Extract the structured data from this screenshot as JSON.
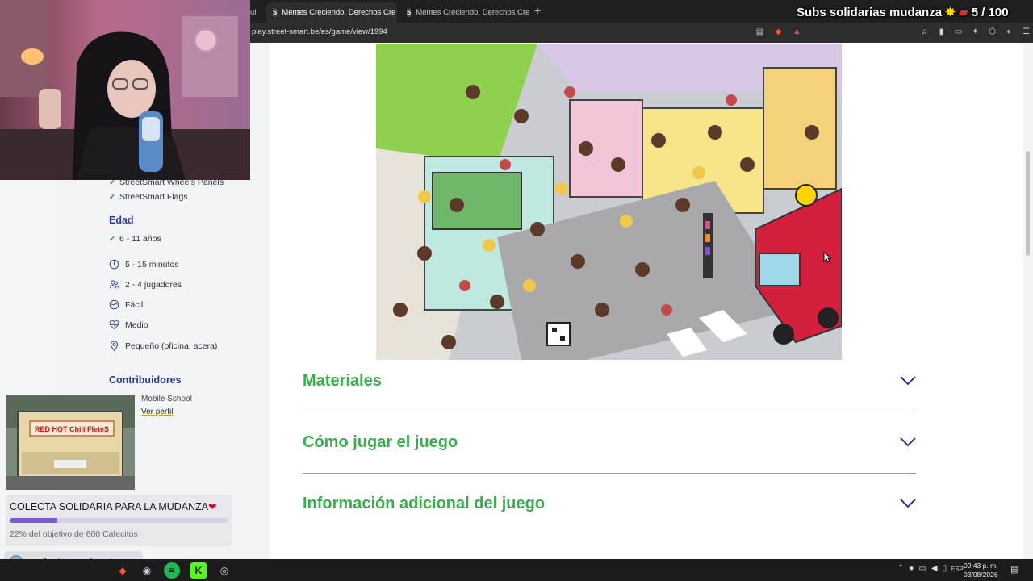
{
  "browser": {
    "tabs": [
      {
        "label": "ul",
        "active": false
      },
      {
        "label": "Mentes Creciendo, Derechos Cre",
        "favicon": "S",
        "active": true
      },
      {
        "label": "Mentes Creciendo, Derechos Crecien",
        "favicon": "S",
        "active": false
      }
    ],
    "new_tab_icon": "plus-icon",
    "url": "play.street-smart.be/es/game/view/1994"
  },
  "stream_overlay": {
    "title": "Subs solidarias mudanza",
    "counter": "5 / 100"
  },
  "sidebar": {
    "partial_items": [
      "StreetSmart Wheels Panels",
      "StreetSmart Flags"
    ],
    "age_heading": "Edad",
    "age_value": "6 - 11 años",
    "details": [
      {
        "icon": "clock-icon",
        "label": "5 - 15 minutos"
      },
      {
        "icon": "players-icon",
        "label": "2 - 4 jugadores"
      },
      {
        "icon": "easy-icon",
        "label": "Fácil"
      },
      {
        "icon": "heartbeat-icon",
        "label": "Medio"
      },
      {
        "icon": "location-pin-icon",
        "label": "Pequeño (oficina, acera)"
      }
    ],
    "contributors_heading": "Contribuidores",
    "contributor_name": "Mobile School",
    "contributor_link": "Ver perfil"
  },
  "accordion": [
    {
      "title": "Materiales"
    },
    {
      "title": "Cómo jugar el juego"
    },
    {
      "title": "Información adicional del juego"
    }
  ],
  "donation": {
    "title": "COLECTA SOLIDARIA PARA LA MUDANZA",
    "progress": 0.22,
    "subtitle": "22% del objetivo de 600 Cafecitos",
    "link": "cafecito.app/naninu_",
    "truck_sign": "RED HOT Chili FleteS"
  },
  "taskbar": {
    "lang": "ESP",
    "time": "09:43 p. m.",
    "date": "03/08/2026"
  },
  "colors": {
    "accent_green": "#3aae4e",
    "heading_blue": "#2b3a8f",
    "progress_purple": "#7a5bd0"
  }
}
